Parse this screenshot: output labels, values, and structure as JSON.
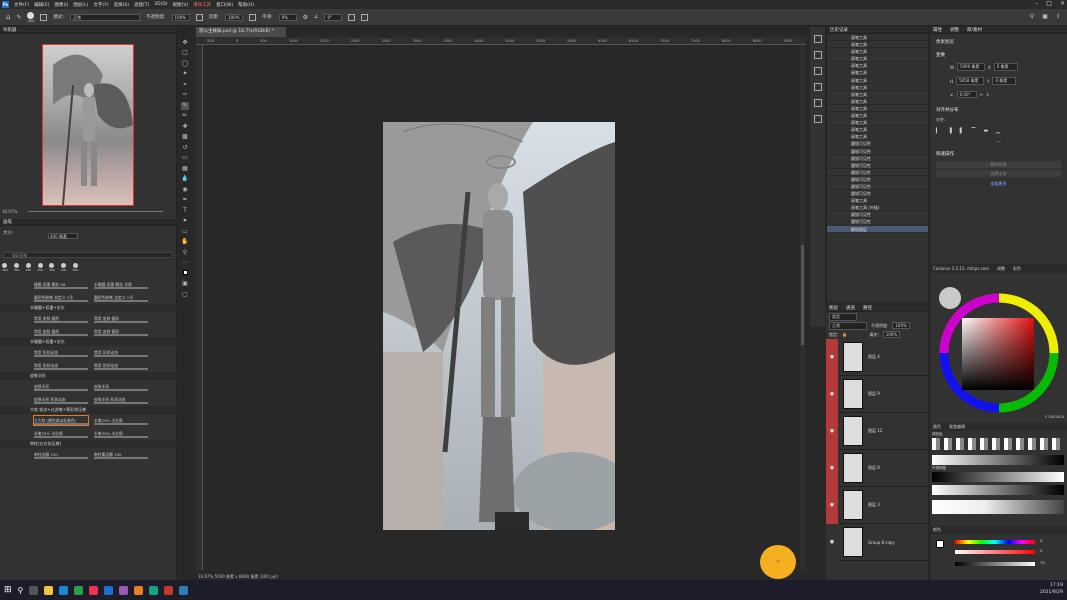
{
  "menubar": {
    "logo": "Ps",
    "items": [
      "文件(F)",
      "编辑(E)",
      "图像(I)",
      "图层(L)",
      "文字(Y)",
      "选择(S)",
      "滤镜(T)",
      "3D(D)",
      "视图(V)",
      "增效工具",
      "窗口(W)",
      "帮助(H)"
    ],
    "highlight_index": 9
  },
  "optbar": {
    "brush_size": "400",
    "mode_label": "模式:",
    "mode_value": "正常",
    "opacity_label": "不透明度:",
    "opacity_value": "100%",
    "flow_label": "流量:",
    "flow_value": "100%",
    "smooth_label": "平滑:",
    "smooth_value": "0%",
    "angle_value": "0°"
  },
  "navigator": {
    "title": "导航器",
    "zoom": "16.67%"
  },
  "brushes": {
    "title": "画笔",
    "size_label": "大小:",
    "size_value": "400 像素",
    "search_placeholder": "搜索画笔",
    "presets": [
      "400",
      "300",
      "250",
      "250",
      "300",
      "500",
      "300"
    ],
    "rows": [
      [
        "硬圆 双重 颗粒 58",
        "半硬圆 双重 颗粒 半角"
      ],
      [
        "圆形色粉笔 自定义 1号",
        "圆形色粉笔 自定义 1号"
      ],
      [
        "常用 皮肤 圆形",
        "常用 皮肤 圆形"
      ],
      [
        "常用 皮肤 圆形",
        "常用 皮肤 圆形"
      ],
      [
        "常用 形状动态",
        "常用 形状动态"
      ],
      [
        "常用 形状动态",
        "常用 形状动态"
      ],
      [
        "皮肤半形",
        "皮肤半形"
      ],
      [
        "皮肤半形 形状动态",
        "皮肤半形 形状动态"
      ],
      [
        "大大软 (颜色减淡低着色)",
        "半笔25% 半尖角"
      ],
      [
        "半笔25% 半尖角",
        "半笔50% 半尖角"
      ],
      [
        "带柱边圆 100",
        "带柱柔边圆 100"
      ]
    ],
    "groups": [
      "半硬圆+双重+尖头",
      "半硬圆+双重+尖头",
      "皮肤半形",
      "大软 软边+过滤笔+等形状压感",
      "带柱(左右仿压感)"
    ]
  },
  "document": {
    "tab": "游公主妹妹.psd @ 16.7%(RGB/8) *",
    "ruler_ticks": [
      "-500",
      "0",
      "500",
      "1000",
      "1500",
      "2000",
      "2500",
      "3000",
      "3500",
      "4000",
      "4500",
      "5000",
      "5500",
      "6000",
      "6500",
      "7000",
      "7500",
      "8000",
      "8500",
      "9000",
      "9500"
    ],
    "status": "16.67%   5000 像素 x 8600 像素 (300 ppi)"
  },
  "history": {
    "title": "历史记录",
    "items": [
      "画笔工具",
      "画笔工具",
      "画笔工具",
      "画笔工具",
      "画笔工具",
      "画笔工具",
      "画笔工具",
      "画笔工具",
      "画笔工具",
      "画笔工具",
      "画笔工具",
      "画笔工具",
      "画笔工具",
      "画笔工具",
      "画笔工具",
      "圆锁可见性",
      "圆锁可见性",
      "圆锁可见性",
      "圆锁可见性",
      "圆锁可见性",
      "圆锁可见性",
      "圆锁可见性",
      "圆锁可见性",
      "画笔工具",
      "画笔工具 (外链)",
      "圆锁可见性",
      "圆锁可见性",
      "解锁图层"
    ],
    "selected_index": 27
  },
  "layers": {
    "tabs": [
      "图层",
      "通道",
      "路径"
    ],
    "kind_label": "类型",
    "blend_mode": "正常",
    "opacity_label": "不透明度:",
    "opacity_value": "100%",
    "lock_label": "锁定:",
    "fill_label": "填充:",
    "fill_value": "100%",
    "items": [
      {
        "name": "图层 4",
        "visible_red": true
      },
      {
        "name": "图层 9",
        "visible_red": true
      },
      {
        "name": "图层 12",
        "visible_red": true
      },
      {
        "name": "图层 8",
        "visible_red": true
      },
      {
        "name": "图层 3",
        "visible_red": true
      },
      {
        "name": "Group 8 copy",
        "visible_red": false
      }
    ]
  },
  "properties": {
    "tabs": [
      "属性",
      "调整",
      "库/素材"
    ],
    "section_pixel": "像素图层",
    "transform_title": "变换",
    "w_label": "W",
    "w_value": "5000 像素",
    "h_label": "H",
    "h_value": "5858 像素",
    "x_label": "X",
    "x_value": "0 像素",
    "y_label": "Y",
    "y_value": "0 像素",
    "angle_value": "0.00°",
    "align_title": "对齐并分布",
    "align_label": "对齐:",
    "quick_title": "快速操作",
    "quick_btn1": "删除背景",
    "quick_btn2": "选择主体",
    "quick_link": "查看更多"
  },
  "coolorus": {
    "title": "Coolorus 2.5.15. mfcps.com",
    "tabs": [
      "调整",
      "彩色"
    ],
    "hex": "F CACACA"
  },
  "swatches": {
    "tabs": [
      "颜色",
      "渐变编辑"
    ],
    "label1": "调色板",
    "label2": "不透明度"
  },
  "colorsliders": {
    "title": "颜色",
    "values": [
      "0",
      "0",
      "79"
    ]
  },
  "taskbar": {
    "time": "17:19",
    "date": "2021/9/29"
  },
  "colors": {
    "accent": "#b43a3a",
    "highlight": "#4a5a72",
    "panel": "#323232"
  }
}
